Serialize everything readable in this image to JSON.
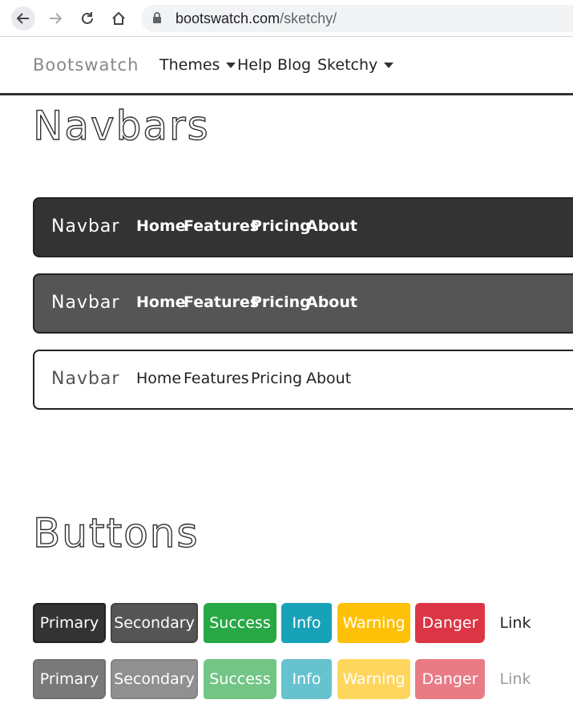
{
  "browser": {
    "url_host": "bootswatch.com",
    "url_path": "/sketchy/"
  },
  "site_nav": {
    "brand": "Bootswatch",
    "items": [
      {
        "label": "Themes",
        "dropdown": true
      },
      {
        "label": "Help",
        "dropdown": false
      },
      {
        "label": "Blog",
        "dropdown": false
      },
      {
        "label": "Sketchy",
        "dropdown": true
      }
    ]
  },
  "sections": {
    "navbars_title": "Navbars",
    "buttons_title": "Buttons"
  },
  "demo_navbars": [
    {
      "variant": "dark",
      "brand": "Navbar",
      "links": [
        "Home",
        "Features",
        "Pricing",
        "About"
      ]
    },
    {
      "variant": "secondary",
      "brand": "Navbar",
      "links": [
        "Home",
        "Features",
        "Pricing",
        "About"
      ]
    },
    {
      "variant": "light",
      "brand": "Navbar",
      "links": [
        "Home",
        "Features",
        "Pricing",
        "About"
      ]
    }
  ],
  "buttons": {
    "row1": [
      "Primary",
      "Secondary",
      "Success",
      "Info",
      "Warning",
      "Danger",
      "Link"
    ],
    "row2": [
      "Primary",
      "Secondary",
      "Success",
      "Info",
      "Warning",
      "Danger",
      "Link"
    ]
  },
  "colors": {
    "primary": "#333333",
    "secondary": "#555555",
    "success": "#28a745",
    "info": "#17a2b8",
    "warning": "#ffc107",
    "danger": "#dc3545"
  }
}
